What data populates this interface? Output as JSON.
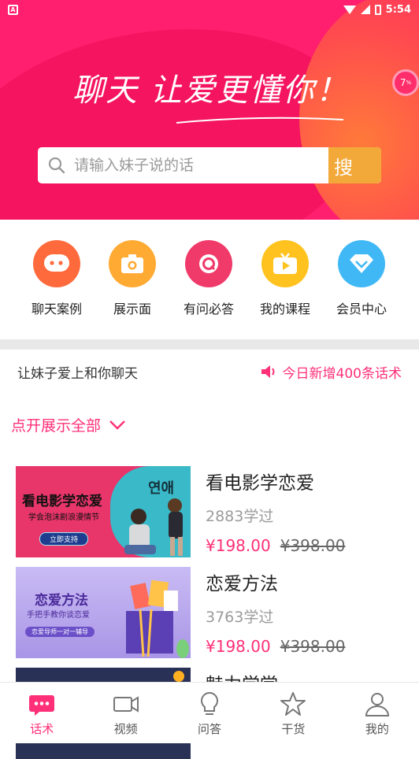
{
  "status_bar": {
    "time": "5:54",
    "notif_glyph": "A"
  },
  "hero": {
    "title": "聊天  让爱更懂你！",
    "badge": "7",
    "badge_sup": "%",
    "colors": {
      "bg": "#ff1f6e",
      "accent": "#ff7a3a"
    }
  },
  "search": {
    "placeholder": "请输入妹子说的话",
    "button_label": "搜",
    "button_color": "#f2a93a"
  },
  "nav": {
    "items": [
      {
        "label": "聊天案例",
        "icon": "chat-bubble-icon",
        "color": "#ff6a3d"
      },
      {
        "label": "展示面",
        "icon": "camera-icon",
        "color": "#ffaa33"
      },
      {
        "label": "有问必答",
        "icon": "qa-icon",
        "color": "#f03a6a"
      },
      {
        "label": "我的课程",
        "icon": "tv-icon",
        "color": "#ffc21f"
      },
      {
        "label": "会员中心",
        "icon": "diamond-icon",
        "color": "#40b8f5"
      }
    ]
  },
  "notice": {
    "left": "让妹子爱上和你聊天",
    "right": "今日新增400条话术",
    "icon": "speaker-icon"
  },
  "show_all": {
    "label": "点开展示全部",
    "icon": "chevron-down-icon"
  },
  "courses": [
    {
      "title": "看电影学恋爱",
      "learned": "2883学过",
      "price": "¥198.00",
      "old_price": "¥398.00",
      "thumb": {
        "headline": "看电影学恋爱",
        "sub": "学会泡沫剧浪漫情节",
        "button": "立即支持",
        "side": "연애",
        "bg": "#e8356a"
      }
    },
    {
      "title": "恋爱方法",
      "learned": "3763学过",
      "price": "¥198.00",
      "old_price": "¥398.00",
      "thumb": {
        "headline": "恋爱方法",
        "sub": "手把手教你谈恋爱",
        "button": "恋爱导师一对一辅导",
        "bg": "#b9a7ee"
      }
    },
    {
      "title": "魅力学堂",
      "thumb": {
        "bg": "#2a3157"
      }
    }
  ],
  "tabbar": {
    "items": [
      {
        "label": "话术",
        "icon": "chat-bubble-icon",
        "active": true
      },
      {
        "label": "视频",
        "icon": "video-camera-icon",
        "active": false
      },
      {
        "label": "问答",
        "icon": "lightbulb-icon",
        "active": false
      },
      {
        "label": "干货",
        "icon": "star-icon",
        "active": false
      },
      {
        "label": "我的",
        "icon": "person-icon",
        "active": false
      }
    ],
    "active_color": "#ff2f78"
  }
}
